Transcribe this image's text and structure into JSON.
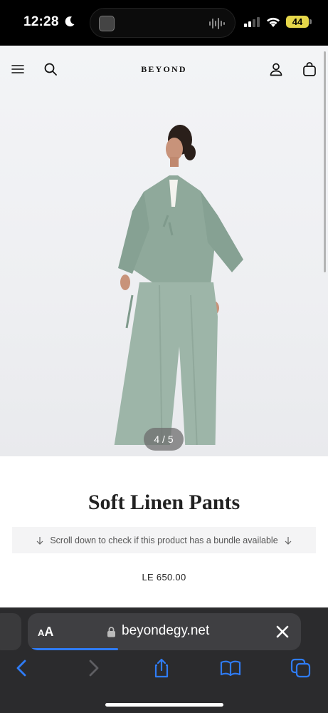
{
  "status_bar": {
    "time": "12:28",
    "battery": "44",
    "battery_color": "#e5d64a"
  },
  "site": {
    "logo": "BEYOND",
    "icons": [
      "menu-icon",
      "search-icon",
      "account-icon",
      "bag-icon"
    ]
  },
  "gallery": {
    "pager": "4 / 5",
    "current_image": 4,
    "total_images": 5
  },
  "product": {
    "title": "Soft Linen Pants",
    "bundle_notice": "Scroll down to check if this product has a bundle available",
    "price": "LE 650.00"
  },
  "browser": {
    "aa_label_small": "A",
    "aa_label_large": "A",
    "url": "beyondegy.net",
    "accent_color": "#2f7cf6",
    "load_progress": 0.33,
    "toolbar_icons": [
      "back-icon",
      "forward-icon",
      "share-icon",
      "bookmarks-icon",
      "tabs-icon"
    ]
  }
}
